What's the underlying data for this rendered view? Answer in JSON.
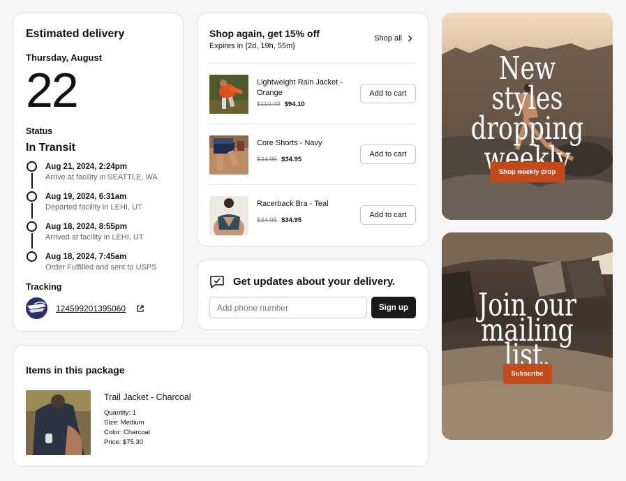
{
  "delivery": {
    "title": "Estimated delivery",
    "date_label": "Thursday, August",
    "day": "22",
    "status_label": "Status",
    "status_value": "In Transit",
    "timeline": [
      {
        "date": "Aug 21, 2024, 2:24pm",
        "desc": "Arrive at facility in SEATTLE, WA"
      },
      {
        "date": "Aug 19, 2024, 6:31am",
        "desc": "Departed facility in LEHI, UT"
      },
      {
        "date": "Aug 18, 2024, 8:55pm",
        "desc": "Arrived at facility in LEHI, UT"
      },
      {
        "date": "Aug 18, 2024, 7:45am",
        "desc": "Order Fulfilled and sent to USPS"
      }
    ],
    "tracking_label": "Tracking",
    "tracking_number": "124599201395060"
  },
  "shop_again": {
    "title": "Shop again, get 15% off",
    "expires": "Expires in {2d, 19h, 55m}",
    "shop_all": "Shop all",
    "products": [
      {
        "name": "Lightweight Rain Jacket - Orange",
        "old_price": "$110.00",
        "new_price": "$94.10",
        "button": "Add to cart"
      },
      {
        "name": "Core Shorts - Navy",
        "old_price": "$34.95",
        "new_price": "$34.95",
        "button": "Add to cart"
      },
      {
        "name": "Racerback Bra - Teal",
        "old_price": "$34.95",
        "new_price": "$34.95",
        "button": "Add to cart"
      }
    ]
  },
  "updates": {
    "title": "Get updates about your delivery.",
    "phone_placeholder": "Add phone number",
    "signup_label": "Sign up"
  },
  "package": {
    "title": "Items in this package",
    "item_name": "Trail Jacket - Charcoal",
    "quantity": "Quantity: 1",
    "size": "Size: Medium",
    "color": "Color: Charcoal",
    "price": "Price: $75.30"
  },
  "promo1": {
    "line1": "New styles",
    "line2": "dropping",
    "line3": "weekly",
    "button": "Shop weekly drop",
    "accent": "#c24a1d"
  },
  "promo2": {
    "line1": "Join our",
    "line2": "mailing list.",
    "button": "Subscribe",
    "accent": "#c24a1d"
  }
}
